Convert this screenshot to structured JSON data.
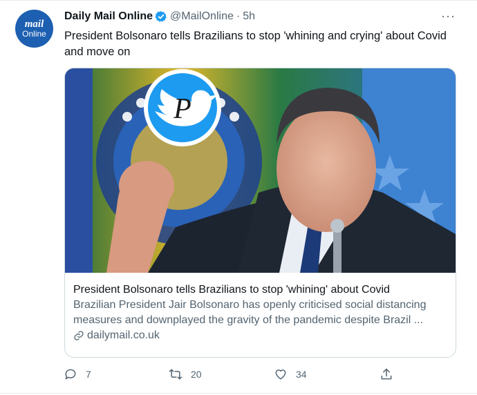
{
  "author": {
    "avatar_line1": "mail",
    "avatar_line2": "Online",
    "name": "Daily Mail Online",
    "handle": "@MailOnline",
    "separator": "·",
    "time": "5h"
  },
  "more_label": "···",
  "tweet_text": "President Bolsonaro tells Brazilians to stop 'whining and crying' about Covid and move on",
  "card": {
    "watermark_letter": "P",
    "title": "President Bolsonaro tells Brazilians to stop 'whining' about Covid",
    "description_line1": "Brazilian President Jair Bolsonaro has openly criticised social distancing",
    "description_line2": "measures and downplayed the gravity of the pandemic despite Brazil ...",
    "domain": "dailymail.co.uk"
  },
  "actions": {
    "reply_count": "7",
    "retweet_count": "20",
    "like_count": "34"
  },
  "icons": [
    "verified-badge-icon",
    "more-icon",
    "link-icon",
    "reply-icon",
    "retweet-icon",
    "like-icon",
    "share-icon"
  ],
  "colors": {
    "verified_blue": "#1d9bf0",
    "text": "#0f1419",
    "secondary_text": "#536471",
    "avatar_blue": "#1d5fb0"
  }
}
